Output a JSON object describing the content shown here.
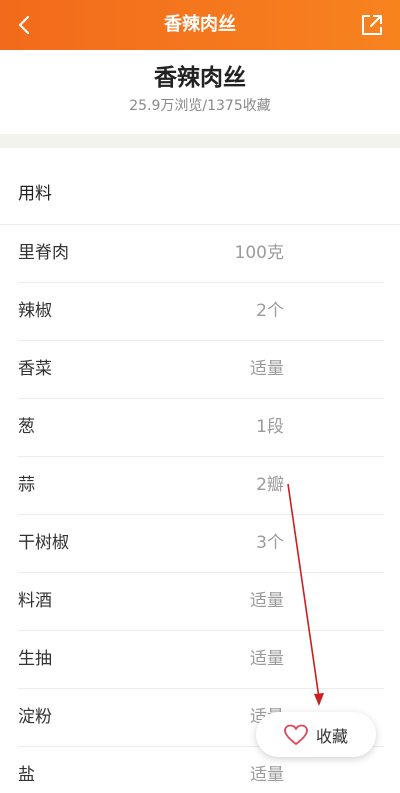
{
  "topbar": {
    "title": "香辣肉丝",
    "background_color": "#f26a1b",
    "back_icon": "chevron-left-icon",
    "share_icon": "share-icon"
  },
  "header": {
    "title": "香辣肉丝",
    "stats": "25.9万浏览/1375收藏"
  },
  "ingredients": {
    "section_title": "用料",
    "items": [
      {
        "name": "里脊肉",
        "amount": "100克"
      },
      {
        "name": "辣椒",
        "amount": "2个"
      },
      {
        "name": "香菜",
        "amount": "适量"
      },
      {
        "name": "葱",
        "amount": "1段"
      },
      {
        "name": "蒜",
        "amount": "2瓣"
      },
      {
        "name": "干树椒",
        "amount": "3个"
      },
      {
        "name": "料酒",
        "amount": "适量"
      },
      {
        "name": "生抽",
        "amount": "适量"
      },
      {
        "name": "淀粉",
        "amount": "适量"
      },
      {
        "name": "盐",
        "amount": "适量"
      }
    ]
  },
  "favorite": {
    "label": "收藏",
    "icon": "heart-icon",
    "icon_color": "#e0455a"
  },
  "annotation": {
    "arrow_color": "#cc1f1f"
  }
}
